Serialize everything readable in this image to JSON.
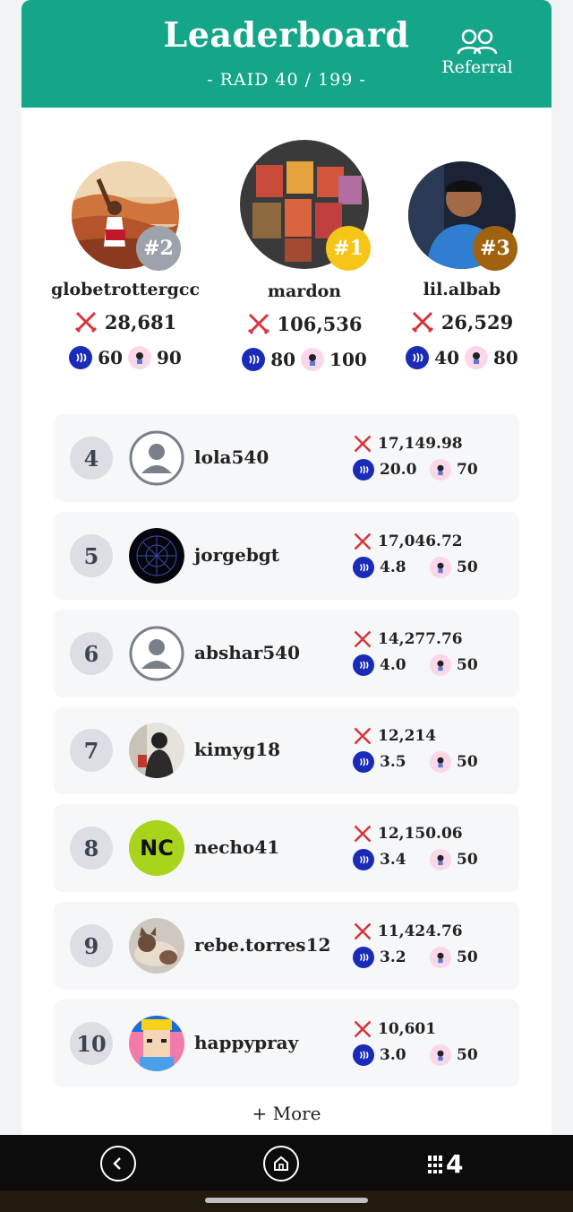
{
  "header": {
    "title": "Leaderboard",
    "subtitle": "- RAID 40 / 199 -",
    "referral_label": "Referral"
  },
  "podium": [
    {
      "rank": "#2",
      "name": "globetrottergcc",
      "score": "28,681",
      "coin": "60",
      "mascot": "90"
    },
    {
      "rank": "#1",
      "name": "mardon",
      "score": "106,536",
      "coin": "80",
      "mascot": "100"
    },
    {
      "rank": "#3",
      "name": "lil.albab",
      "score": "26,529",
      "coin": "40",
      "mascot": "80"
    }
  ],
  "rows": [
    {
      "rank": "4",
      "name": "lola540",
      "score": "17,149.98",
      "coin": "20.0",
      "mascot": "70"
    },
    {
      "rank": "5",
      "name": "jorgebgt",
      "score": "17,046.72",
      "coin": "4.8",
      "mascot": "50"
    },
    {
      "rank": "6",
      "name": "abshar540",
      "score": "14,277.76",
      "coin": "4.0",
      "mascot": "50"
    },
    {
      "rank": "7",
      "name": "kimyg18",
      "score": "12,214",
      "coin": "3.5",
      "mascot": "50"
    },
    {
      "rank": "8",
      "name": "necho41",
      "score": "12,150.06",
      "coin": "3.4",
      "mascot": "50",
      "initials": "NC"
    },
    {
      "rank": "9",
      "name": "rebe.torres12",
      "score": "11,424.76",
      "coin": "3.2",
      "mascot": "50"
    },
    {
      "rank": "10",
      "name": "happypray",
      "score": "10,601",
      "coin": "3.0",
      "mascot": "50"
    }
  ],
  "more_label": "+ More",
  "nav": {
    "fort_label": "4"
  },
  "colors": {
    "header": "#15a589",
    "gold": "#f5c518",
    "silver": "#9ea3ab",
    "bronze": "#a0620f",
    "coin": "#1a2bb8"
  }
}
